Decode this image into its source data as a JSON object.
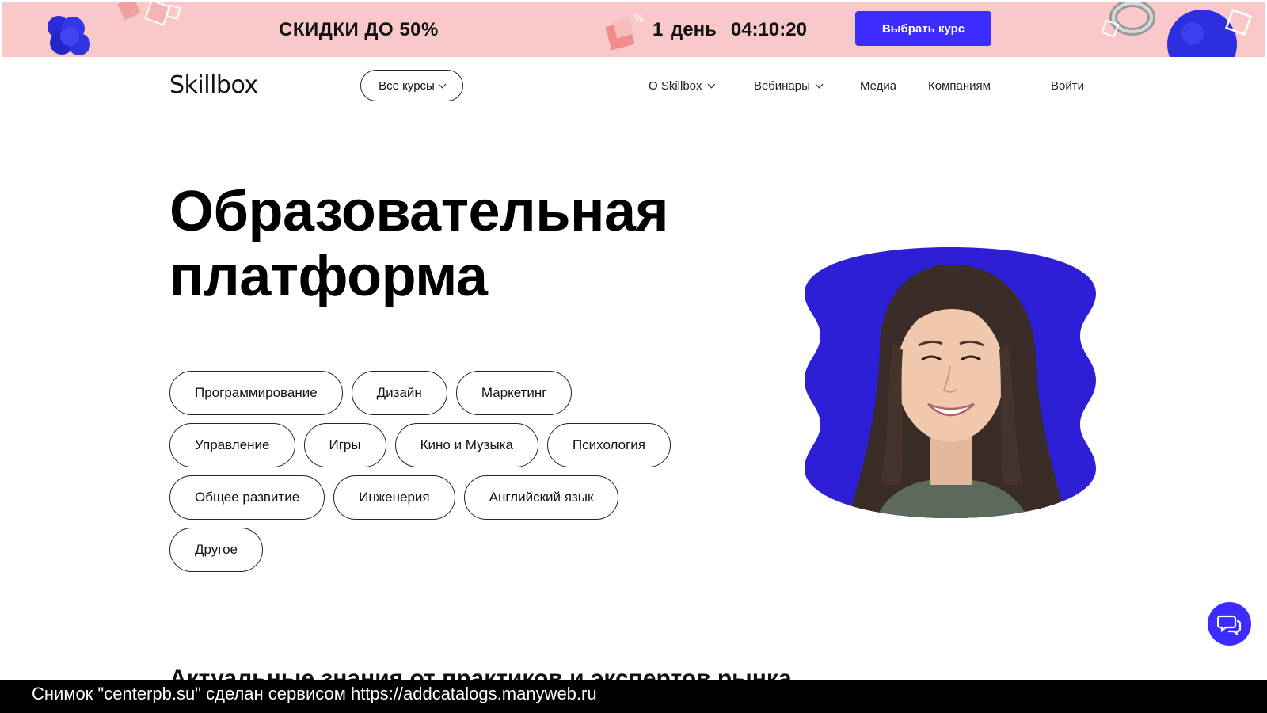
{
  "promo": {
    "title": "СКИДКИ ДО 50%",
    "timer_days": "1 день",
    "timer_time": "04:10:20",
    "cta_label": "Выбрать курс",
    "background": "#f9c9c9",
    "accent": "#3d2cff"
  },
  "header": {
    "logo": "Skillbox",
    "courses_label": "Все курсы",
    "nav": {
      "about": "О Skillbox",
      "webinars": "Вебинары",
      "media": "Медиа",
      "companies": "Компаниям",
      "login": "Войти"
    }
  },
  "hero": {
    "title_line1": "Образовательная",
    "title_line2": "платформа",
    "tags": [
      "Программирование",
      "Дизайн",
      "Маркетинг",
      "Управление",
      "Игры",
      "Кино и Музыка",
      "Психология",
      "Общее развитие",
      "Инженерия",
      "Английский язык",
      "Другое"
    ],
    "photo_bg": "#2c1fd6"
  },
  "section_peek": "Актуальные знания от практиков и экспертов рынка",
  "chat_icon": "chat-bubbles-icon",
  "watermark": "Снимок \"centerpb.su\" сделан сервисом https://addcatalogs.manyweb.ru"
}
